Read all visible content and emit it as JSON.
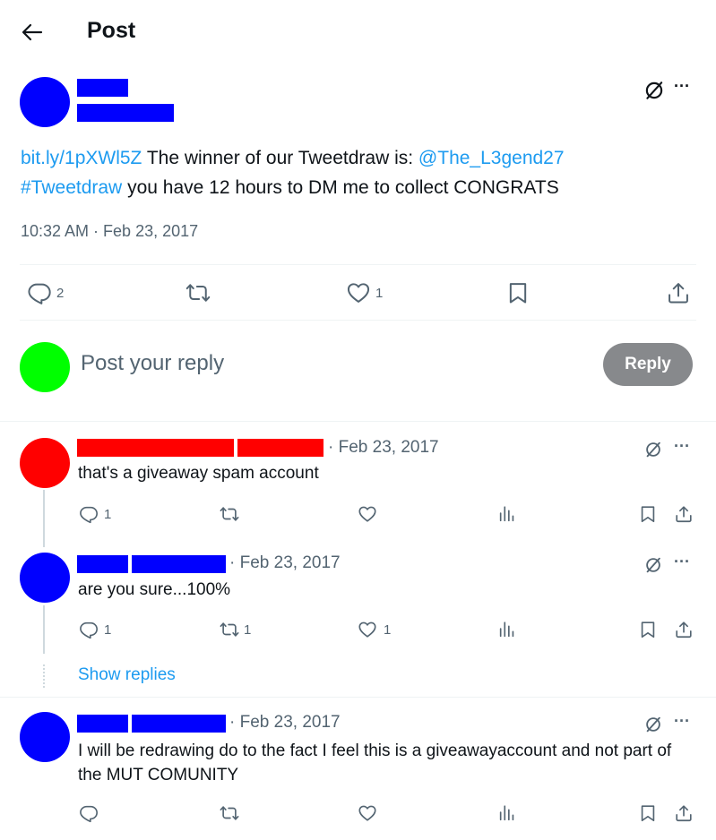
{
  "header": {
    "title": "Post"
  },
  "main_post": {
    "avatar_color": "#0000ff",
    "redaction_color": "#0000ff",
    "link": "bit.ly/1pXWl5Z",
    "text_1": " The winner of our Tweetdraw is: ",
    "mention": "@The_L3gend27",
    "hashtag": "#Tweetdraw",
    "text_2": " you have 12 hours to DM me to collect CONGRATS",
    "timestamp": "10:32 AM · Feb 23, 2017",
    "reply_count": "2",
    "like_count": "1"
  },
  "composer": {
    "avatar_color": "#00ff00",
    "placeholder": "Post your reply",
    "reply_button": "Reply"
  },
  "replies": [
    {
      "avatar_color": "#ff0000",
      "redaction_color": "#ff0000",
      "date": "· Feb 23, 2017",
      "text": "that's a giveaway spam account",
      "reply_count": "1",
      "retweet_count": "",
      "like_count": ""
    },
    {
      "avatar_color": "#0000ff",
      "redaction_color": "#0000ff",
      "date": "· Feb 23, 2017",
      "text": "are you sure...100%",
      "reply_count": "1",
      "retweet_count": "1",
      "like_count": "1"
    },
    {
      "avatar_color": "#0000ff",
      "redaction_color": "#0000ff",
      "date": "· Feb 23, 2017",
      "text": "I will be redrawing do to the fact I feel this is a giveawayaccount and not part of the MUT COMUNITY",
      "reply_count": "",
      "retweet_count": "",
      "like_count": ""
    }
  ],
  "show_replies": "Show replies",
  "colors": {
    "accent": "#1d9bf0",
    "text": "#0f1419",
    "secondary": "#536471",
    "reply_button_bg": "#87898c"
  }
}
